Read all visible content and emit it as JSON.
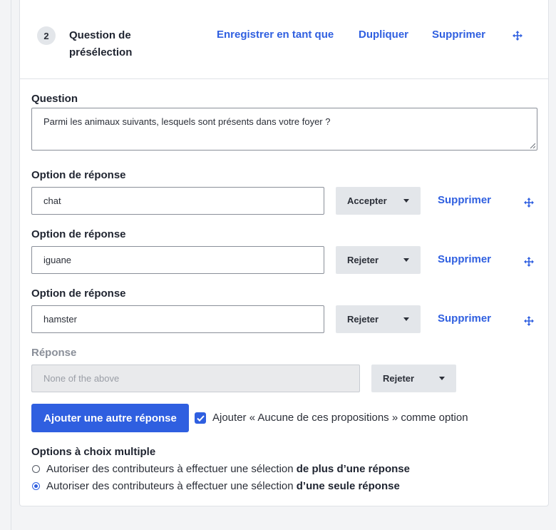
{
  "step": {
    "number": "2",
    "title": "Question de présélection",
    "actions": {
      "save_as": "Enregistrer en tant que",
      "duplicate": "Dupliquer",
      "delete": "Supprimer"
    }
  },
  "question": {
    "label": "Question",
    "value": "Parmi les animaux suivants, lesquels sont présents dans votre foyer ?"
  },
  "answer_options": [
    {
      "label": "Option de réponse",
      "value": "chat",
      "action": "Accepter",
      "delete": "Supprimer"
    },
    {
      "label": "Option de réponse",
      "value": "iguane",
      "action": "Rejeter",
      "delete": "Supprimer"
    },
    {
      "label": "Option de réponse",
      "value": "hamster",
      "action": "Rejeter",
      "delete": "Supprimer"
    }
  ],
  "none_option": {
    "label": "Réponse",
    "value": "None of the above",
    "action": "Rejeter"
  },
  "add_answer_button": "Ajouter une autre réponse",
  "add_none_checkbox": {
    "checked": true,
    "label": "Ajouter « Aucune de ces propositions » comme option"
  },
  "multiple_choice": {
    "title": "Options à choix multiple",
    "options": [
      {
        "prefix": "Autoriser des contributeurs à effectuer une sélection ",
        "emphasis": "de plus d’une réponse",
        "selected": false
      },
      {
        "prefix": "Autoriser des contributeurs à effectuer une sélection ",
        "emphasis": "d’une seule réponse",
        "selected": true
      }
    ]
  },
  "colors": {
    "accent": "#2f5fe0",
    "background": "#f3f4f6",
    "select_bg": "#e3e6ea"
  },
  "icons": [
    "move-icon",
    "chevron-down-icon",
    "checkmark-icon"
  ]
}
